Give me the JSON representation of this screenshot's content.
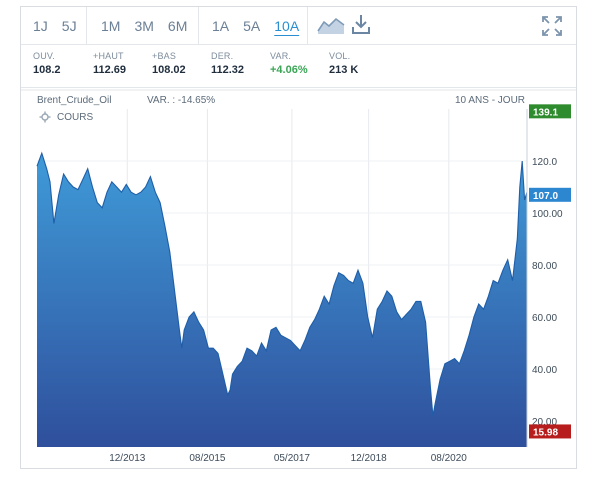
{
  "toolbar": {
    "periods_short": [
      {
        "label": "1J",
        "active": false
      },
      {
        "label": "5J",
        "active": false
      }
    ],
    "periods_month": [
      {
        "label": "1M",
        "active": false
      },
      {
        "label": "3M",
        "active": false
      },
      {
        "label": "6M",
        "active": false
      }
    ],
    "periods_year": [
      {
        "label": "1A",
        "active": false
      },
      {
        "label": "5A",
        "active": false
      },
      {
        "label": "10A",
        "active": true
      }
    ],
    "icons": [
      "chart-type-icon",
      "download-icon",
      "fullscreen-icon"
    ]
  },
  "stats": [
    {
      "label": "OUV.",
      "value": "108.2",
      "tone": "neutral"
    },
    {
      "label": "+HAUT",
      "value": "112.69",
      "tone": "neutral"
    },
    {
      "label": "+BAS",
      "value": "108.02",
      "tone": "neutral"
    },
    {
      "label": "DER.",
      "value": "112.32",
      "tone": "neutral"
    },
    {
      "label": "VAR.",
      "value": "+4.06%",
      "tone": "up"
    },
    {
      "label": "VOL.",
      "value": "213 K",
      "tone": "neutral"
    }
  ],
  "chart_header": {
    "instrument": "Brent_Crude_Oil",
    "variation": "VAR. : -14.65%",
    "range_label": "10 ANS - JOUR",
    "series_tag": "COURS"
  },
  "colors": {
    "accent": "#2a8fd0",
    "area_top": "#3f9bd8",
    "area_bottom": "#2f4f9c",
    "last_badge": "#2d86d0",
    "high_badge": "#2e8b2e",
    "low_badge": "#b81d1d",
    "up": "#3aa655"
  },
  "chart_data": {
    "type": "area",
    "xlabel": "",
    "ylabel": "",
    "ylim": [
      10,
      140
    ],
    "y_ticks": [
      20,
      40,
      60,
      80,
      100,
      120
    ],
    "y_tick_labels": [
      "20.00",
      "40.00",
      "60.00",
      "80.00",
      "100.00",
      "120.0"
    ],
    "x_tick_labels": [
      {
        "label": "12/2013",
        "x": 2013.92
      },
      {
        "label": "08/2015",
        "x": 2015.58
      },
      {
        "label": "05/2017",
        "x": 2017.33
      },
      {
        "label": "12/2018",
        "x": 2018.92
      },
      {
        "label": "08/2020",
        "x": 2020.58
      }
    ],
    "xlim": [
      2012.05,
      2022.2
    ],
    "badges": [
      {
        "label": "139.1",
        "value": 139.1,
        "kind": "high"
      },
      {
        "label": "107.0",
        "value": 107.0,
        "kind": "last"
      },
      {
        "label": "15.98",
        "value": 15.98,
        "kind": "low"
      }
    ],
    "series": [
      {
        "x": [
          2012.05,
          2012.15,
          2012.25,
          2012.32,
          2012.4,
          2012.5,
          2012.6,
          2012.7,
          2012.8,
          2012.9,
          2013.0,
          2013.1,
          2013.2,
          2013.3,
          2013.4,
          2013.5,
          2013.6,
          2013.7,
          2013.8,
          2013.9,
          2014.0,
          2014.1,
          2014.2,
          2014.3,
          2014.4,
          2014.5,
          2014.6,
          2014.7,
          2014.8,
          2014.9,
          2015.0,
          2015.05,
          2015.1,
          2015.2,
          2015.3,
          2015.4,
          2015.5,
          2015.6,
          2015.7,
          2015.8,
          2015.9,
          2016.0,
          2016.05,
          2016.1,
          2016.2,
          2016.3,
          2016.4,
          2016.5,
          2016.6,
          2016.7,
          2016.8,
          2016.9,
          2017.0,
          2017.1,
          2017.2,
          2017.3,
          2017.4,
          2017.5,
          2017.6,
          2017.7,
          2017.8,
          2017.9,
          2018.0,
          2018.1,
          2018.2,
          2018.3,
          2018.4,
          2018.5,
          2018.6,
          2018.7,
          2018.8,
          2018.9,
          2019.0,
          2019.1,
          2019.2,
          2019.3,
          2019.4,
          2019.5,
          2019.6,
          2019.7,
          2019.8,
          2019.9,
          2020.0,
          2020.1,
          2020.2,
          2020.25,
          2020.3,
          2020.4,
          2020.5,
          2020.6,
          2020.7,
          2020.8,
          2020.9,
          2021.0,
          2021.1,
          2021.2,
          2021.3,
          2021.4,
          2021.5,
          2021.6,
          2021.7,
          2021.8,
          2021.9,
          2022.0,
          2022.05,
          2022.1,
          2022.15,
          2022.2
        ],
        "values": [
          118,
          123,
          117,
          112,
          96,
          107,
          115,
          112,
          110,
          109,
          113,
          117,
          110,
          104,
          102,
          108,
          112,
          110,
          108,
          111,
          108,
          107,
          108,
          110,
          114,
          108,
          104,
          95,
          85,
          70,
          55,
          48,
          55,
          60,
          62,
          58,
          55,
          48,
          48,
          46,
          38,
          30,
          32,
          38,
          41,
          43,
          48,
          47,
          45,
          50,
          47,
          55,
          56,
          53,
          52,
          51,
          49,
          47,
          51,
          56,
          59,
          63,
          68,
          65,
          72,
          77,
          76,
          74,
          73,
          78,
          73,
          60,
          52,
          63,
          66,
          70,
          68,
          62,
          59,
          61,
          63,
          66,
          66,
          58,
          33,
          22,
          27,
          36,
          42,
          43,
          44,
          42,
          47,
          53,
          60,
          65,
          63,
          68,
          74,
          73,
          78,
          82,
          74,
          90,
          110,
          120,
          105,
          108
        ]
      }
    ]
  }
}
